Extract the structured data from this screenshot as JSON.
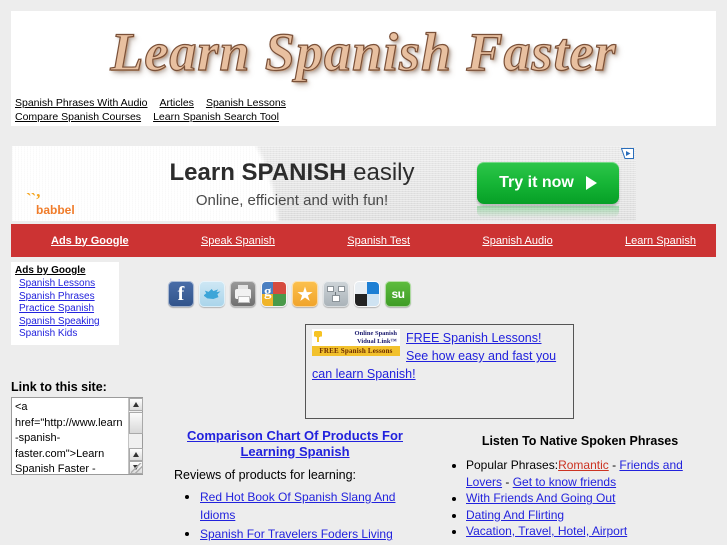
{
  "site": {
    "logo_text": "Learn Spanish Faster"
  },
  "nav": {
    "row1": [
      {
        "label": "Spanish Phrases With Audio"
      },
      {
        "label": "Articles"
      },
      {
        "label": "Spanish Lessons"
      }
    ],
    "row2": [
      {
        "label": "Compare Spanish Courses"
      },
      {
        "label": "Learn Spanish Search Tool"
      }
    ]
  },
  "banner_ad": {
    "brand_marks": "``’",
    "brand_name": "babbel",
    "headline_bold": "Learn SPANISH",
    "headline_light": " easily",
    "subheadline": "Online, efficient and with fun!",
    "cta_label": "Try it now",
    "adchoices_icon": "adchoices-icon"
  },
  "adsense_bar": {
    "background": "#cc3333",
    "items": [
      {
        "label": "Ads by Google",
        "bold": true
      },
      {
        "label": "Speak Spanish",
        "bold": false
      },
      {
        "label": "Spanish Test",
        "bold": false
      },
      {
        "label": "Spanish Audio",
        "bold": false
      },
      {
        "label": "Learn Spanish",
        "bold": false
      }
    ]
  },
  "ads_box": {
    "title": "Ads by Google",
    "links": [
      {
        "label": "Spanish Lessons"
      },
      {
        "label": "Spanish Phrases"
      },
      {
        "label": "Practice Spanish"
      },
      {
        "label": "Spanish Speaking"
      },
      {
        "label": "Spanish Kids"
      }
    ]
  },
  "social": {
    "icons": [
      {
        "name": "facebook-icon",
        "label": "f"
      },
      {
        "name": "twitter-icon",
        "label": ""
      },
      {
        "name": "print-icon",
        "label": ""
      },
      {
        "name": "google-plus-icon",
        "label": "g"
      },
      {
        "name": "favorites-star-icon",
        "label": "★"
      },
      {
        "name": "share-network-icon",
        "label": ""
      },
      {
        "name": "windows-live-icon",
        "label": ""
      },
      {
        "name": "stumbleupon-icon",
        "label": "su"
      }
    ]
  },
  "promo_ad": {
    "logo_line1": "Online Spanish",
    "logo_line2": "Vidual Link™",
    "logo_banner": "FREE Spanish Lessons",
    "link_text": "FREE Spanish Lessons! See how easy and fast you can learn Spanish!"
  },
  "link_to_site": {
    "label": "Link to this site:",
    "textarea_value": "<a href=\"http://www.learn-spanish-faster.com\">Learn Spanish Faster -",
    "scroll_up_icon": "scroll-up-icon",
    "scroll_down_icon": "scroll-down-icon",
    "resize_grip_icon": "resize-grip-icon"
  },
  "middle_column": {
    "heading": "Comparison Chart Of Products For Learning Spanish",
    "intro": "Reviews of products for learning:",
    "items": [
      {
        "label": "Red Hot Book Of Spanish Slang And Idioms"
      },
      {
        "label": "Spanish For Travelers Foders Living"
      }
    ]
  },
  "right_column": {
    "heading": "Listen To Native Spoken Phrases",
    "first_item": {
      "prefix": "Popular Phrases:",
      "link_romantic": "Romantic",
      "sep1": " - ",
      "link_friends_lovers": "Friends and Lovers",
      "sep2": " - ",
      "link_get_to_know": "Get to know friends"
    },
    "items": [
      {
        "label": "With Friends And Going Out"
      },
      {
        "label": "Dating And Flirting"
      },
      {
        "label": "Vacation, Travel, Hotel, Airport"
      }
    ]
  },
  "colors": {
    "link": "#2222dd",
    "visited_link": "#cc3322",
    "ad_bar_red": "#cc3333",
    "cta_green": "#17b637",
    "logo_tan": "#e8c0a0"
  }
}
